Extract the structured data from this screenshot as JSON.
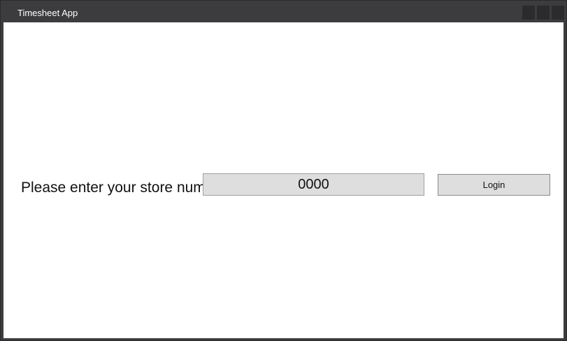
{
  "window": {
    "title": "Timesheet App"
  },
  "form": {
    "prompt_label": "Please enter your store num:",
    "store_number_value": "0000",
    "login_label": "Login"
  },
  "colors": {
    "titlebar": "#3c3c3e",
    "client_background": "#ffffff",
    "control_background": "#dedede"
  }
}
